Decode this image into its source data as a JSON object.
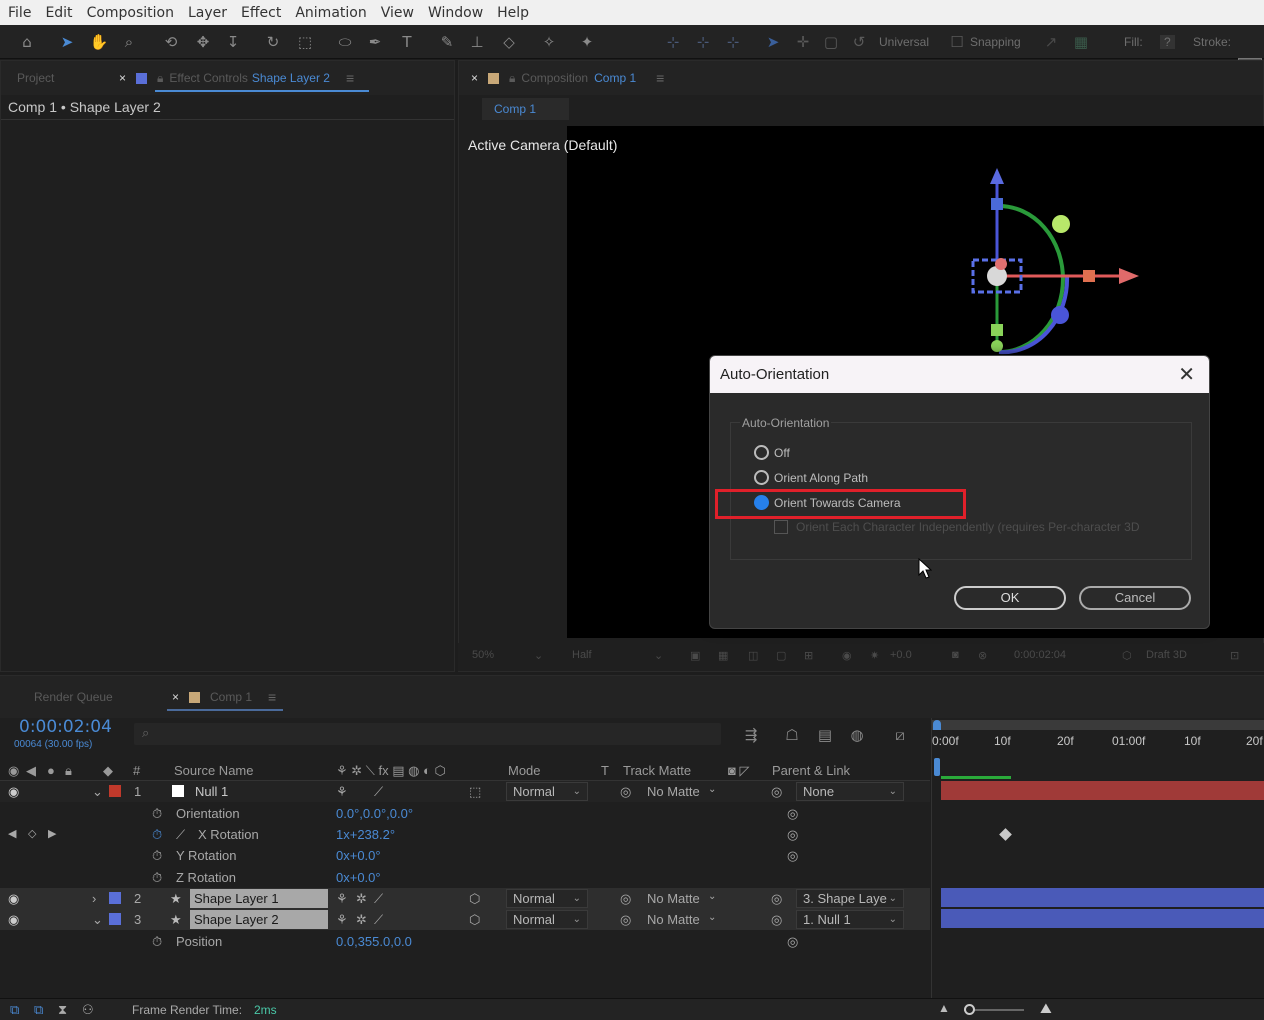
{
  "menu": [
    "File",
    "Edit",
    "Composition",
    "Layer",
    "Effect",
    "Animation",
    "View",
    "Window",
    "Help"
  ],
  "toolbar": {
    "universal": "Universal",
    "snapping": "Snapping",
    "fill": "Fill:",
    "fill_value": "?",
    "stroke": "Stroke:"
  },
  "left_panel": {
    "tab_project": "Project",
    "tab_effect_prefix": "Effect Controls",
    "tab_effect_layer": "Shape Layer 2",
    "breadcrumb": "Comp 1 • Shape Layer 2"
  },
  "comp_panel": {
    "tab_prefix": "Composition",
    "tab_name": "Comp 1",
    "subtab": "Comp 1",
    "camera_label": "Active Camera (Default)"
  },
  "dialog": {
    "title": "Auto-Orientation",
    "group_label": "Auto-Orientation",
    "options": [
      "Off",
      "Orient Along Path",
      "Orient Towards Camera"
    ],
    "selected": "Orient Towards Camera",
    "checkbox_label": "Orient Each Character Independently (requires Per-character 3D",
    "ok": "OK",
    "cancel": "Cancel"
  },
  "viewer_footer": {
    "zoom": "50%",
    "quality": "Half",
    "exposure": "+0.0",
    "timecode": "0:00:02:04",
    "renderer": "Draft 3D"
  },
  "timeline": {
    "tab_render": "Render Queue",
    "tab_comp": "Comp 1",
    "timecode": "0:00:02:04",
    "frames": "00064 (30.00 fps)",
    "headers": {
      "num": "#",
      "source": "Source Name",
      "mode": "Mode",
      "t": "T",
      "track_matte": "Track Matte",
      "parent": "Parent & Link"
    },
    "layers": [
      {
        "num": "1",
        "name": "Null 1",
        "mode": "Normal",
        "matte": "No Matte",
        "parent": "None",
        "color": "#c0392b"
      },
      {
        "num": "2",
        "name": "Shape Layer 1",
        "mode": "Normal",
        "matte": "No Matte",
        "parent": "3. Shape Laye",
        "color": "#5a6fd8"
      },
      {
        "num": "3",
        "name": "Shape Layer 2",
        "mode": "Normal",
        "matte": "No Matte",
        "parent": "1. Null 1",
        "color": "#5a6fd8"
      }
    ],
    "props": {
      "orientation_label": "Orientation",
      "orientation_value": "0.0°,0.0°,0.0°",
      "xrot_label": "X Rotation",
      "xrot_value": "1x+238.2°",
      "yrot_label": "Y Rotation",
      "yrot_value": "0x+0.0°",
      "zrot_label": "Z Rotation",
      "zrot_value": "0x+0.0°",
      "position_label": "Position",
      "position_value": "0.0,355.0,0.0"
    },
    "ruler": [
      "0:00f",
      "10f",
      "20f",
      "01:00f",
      "10f",
      "20f"
    ]
  },
  "status": {
    "label": "Frame Render Time:",
    "value": "2ms"
  },
  "colors": {
    "accent": "#4a8ad4",
    "highlight": "#e0202a",
    "radio_on": "#2680eb"
  }
}
